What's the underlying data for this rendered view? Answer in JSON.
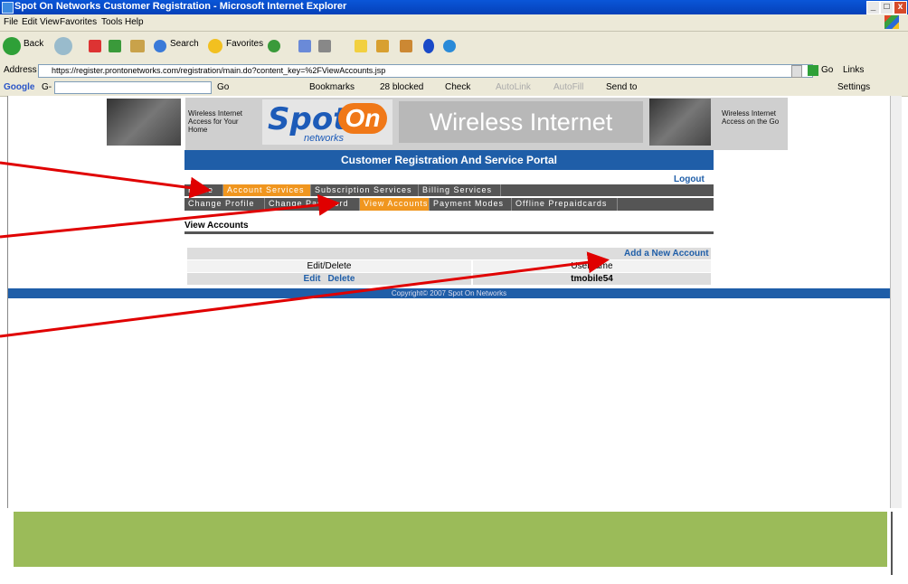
{
  "window": {
    "title": "Spot On Networks Customer Registration - Microsoft Internet Explorer",
    "controls": [
      "_",
      "□",
      "x"
    ]
  },
  "menu": [
    "File",
    "Edit",
    "View",
    "Favorites",
    "Tools",
    "Help"
  ],
  "toolbar": {
    "back_label": "Back",
    "search_label": "Search",
    "favorites_label": "Favorites"
  },
  "address_bar": {
    "label": "Address",
    "url": "https://register.prontonetworks.com/registration/main.do?content_key=%2FViewAccounts.jsp",
    "go_label": "Go",
    "links_label": "Links"
  },
  "google_bar": {
    "logo": "Google",
    "logo_suffix": "G-",
    "go_label": "Go",
    "bookmarks_label": "Bookmarks",
    "blocked_label": "28 blocked",
    "check_label": "Check",
    "autolink_label": "AutoLink",
    "autofill_label": "AutoFill",
    "sendto_label": "Send to",
    "settings_label": "Settings"
  },
  "banner": {
    "left_text": "Wireless Internet Access for Your Home",
    "logo_spot": "Spot",
    "logo_on": "On",
    "logo_networks": "networks",
    "title": "Wireless Internet",
    "right_text": "Wireless Internet Access on the Go"
  },
  "portal_title": "Customer Registration And Service Portal",
  "logout_label": "Logout",
  "nav_primary": [
    {
      "label": "Home",
      "active": false
    },
    {
      "label": "Account Services",
      "active": true
    },
    {
      "label": "Subscription Services",
      "active": false
    },
    {
      "label": "Billing Services",
      "active": false
    }
  ],
  "nav_secondary": [
    {
      "label": "Change Profile",
      "active": false
    },
    {
      "label": "Change Password",
      "active": false
    },
    {
      "label": "View Accounts",
      "active": true
    },
    {
      "label": "Payment Modes",
      "active": false
    },
    {
      "label": "Offline Prepaidcards",
      "active": false
    }
  ],
  "section_title": "View Accounts",
  "table": {
    "add_label": "Add a New Account",
    "headers": [
      "Edit/Delete",
      "Username"
    ],
    "rows": [
      {
        "edit": "Edit",
        "delete": "Delete",
        "username": "tmobile54"
      }
    ]
  },
  "footer": "Copyright© 2007 Spot On Networks",
  "colors": {
    "brand_blue": "#1f5ea8",
    "active_orange": "#f0961f",
    "nav_gray": "#555555",
    "annotation_red": "#e00000",
    "slide_green": "#9bbb59"
  }
}
